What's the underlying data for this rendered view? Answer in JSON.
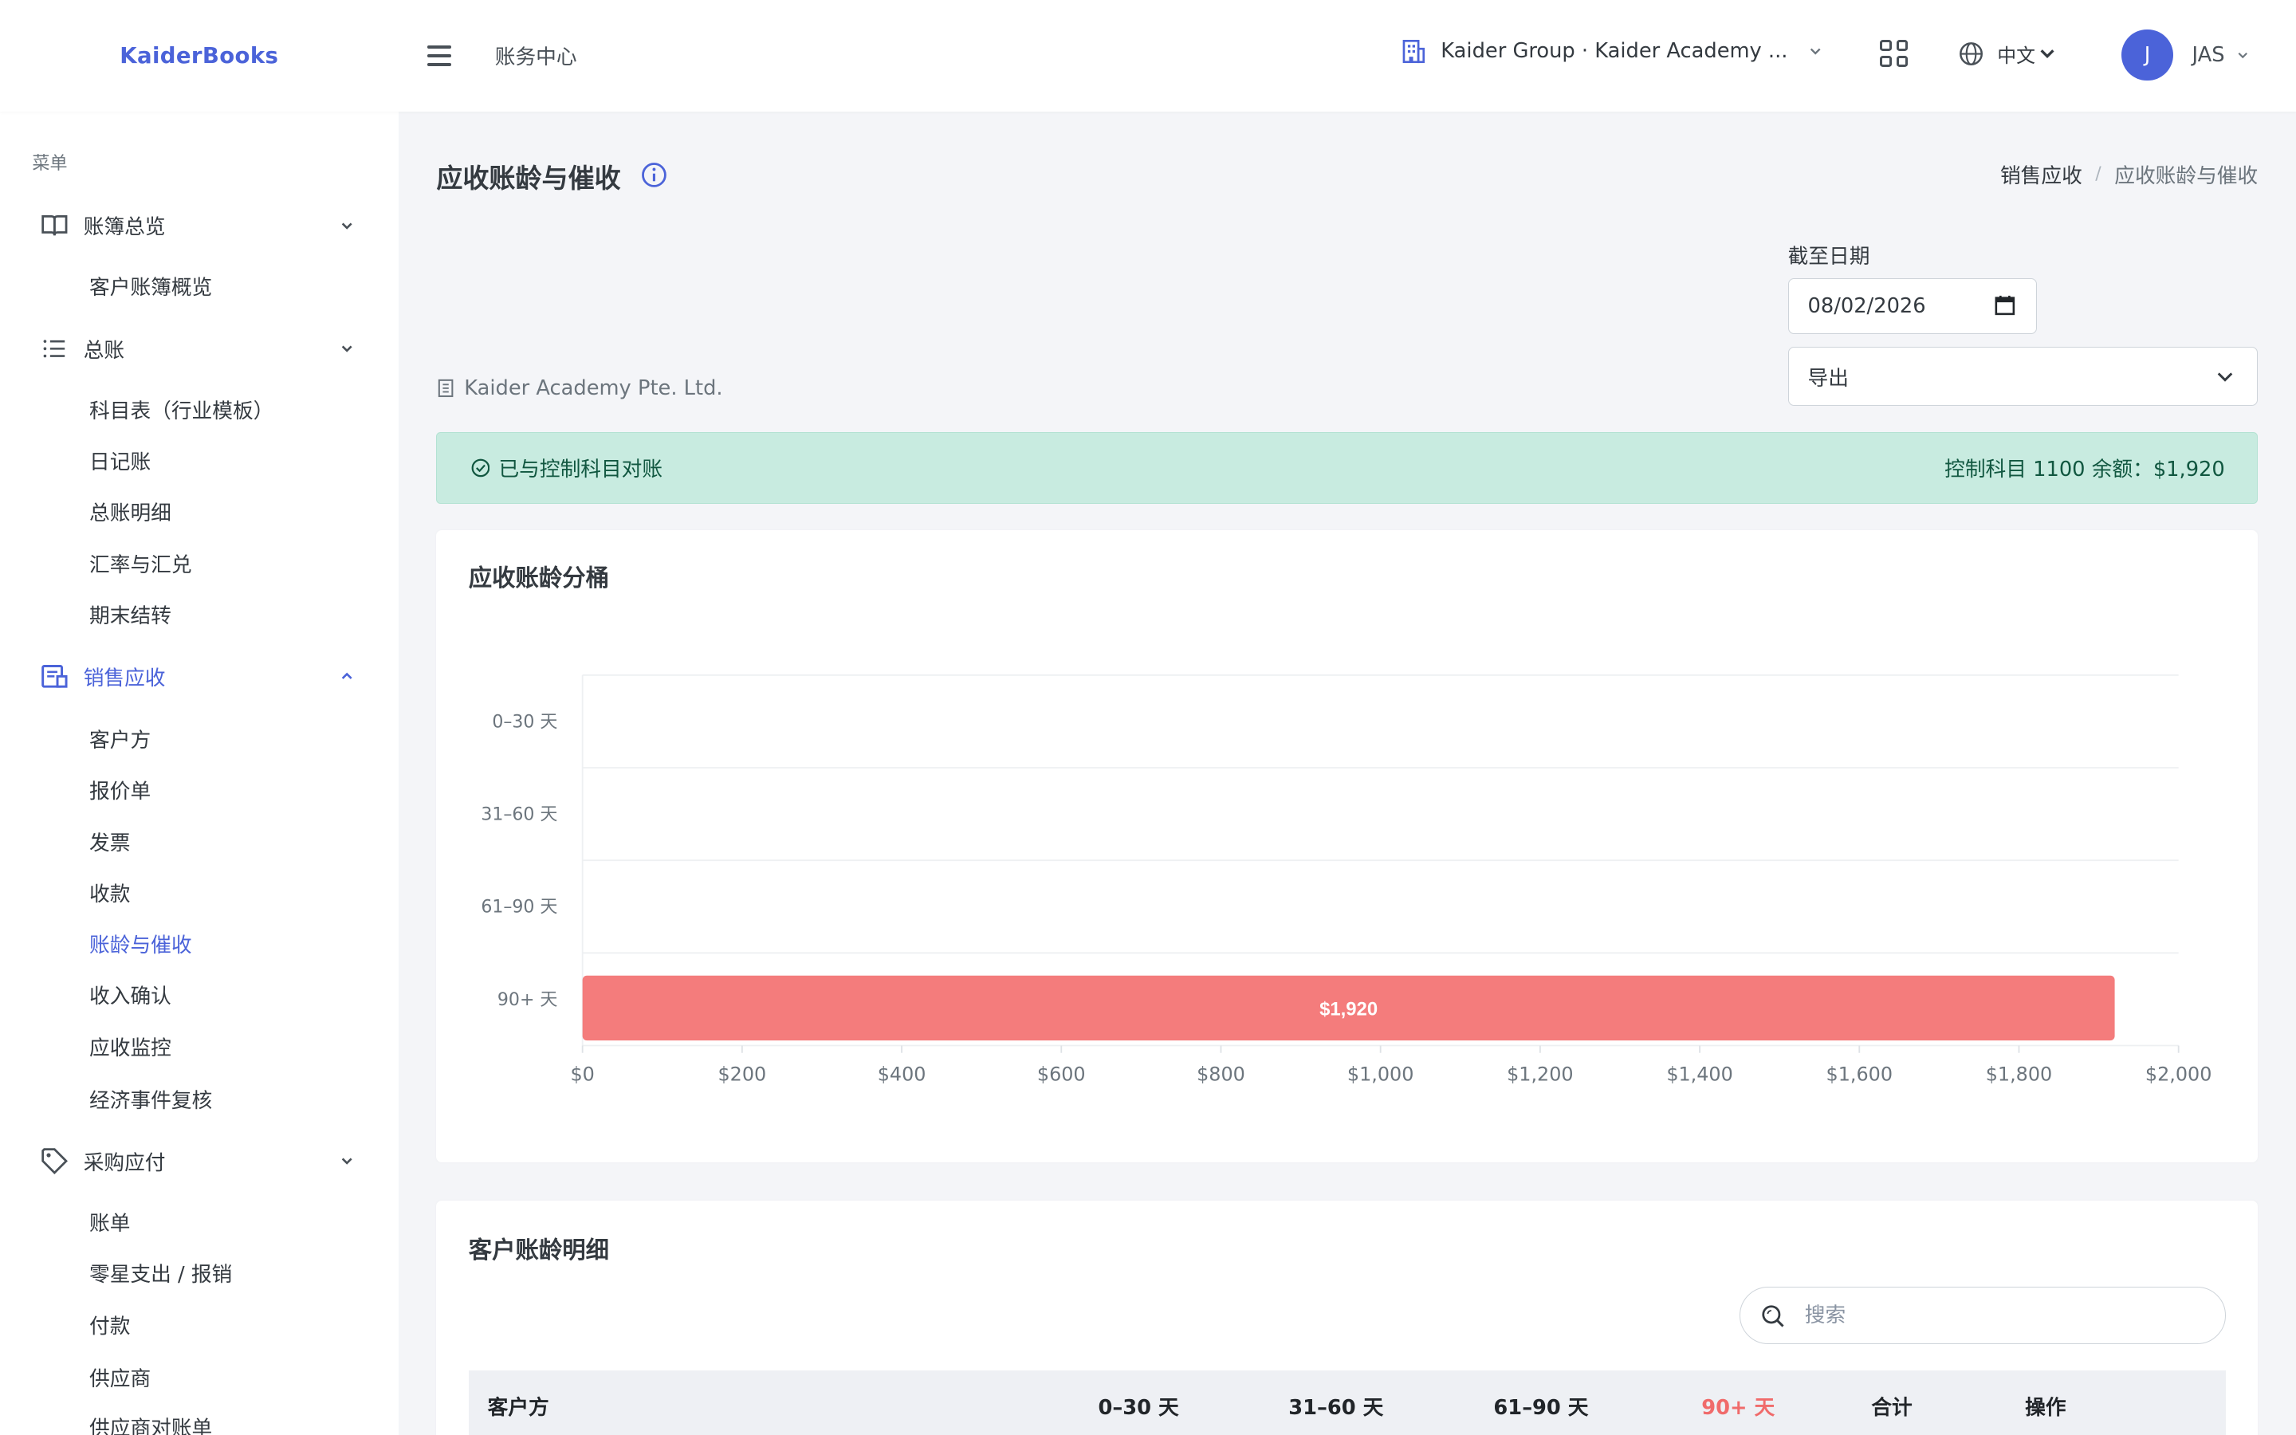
{
  "header": {
    "brand": "KaiderBooks",
    "page_context": "账务中心",
    "org_switcher": "Kaider Group · Kaider Academy ...",
    "language": "中文",
    "user_initial": "J",
    "user_name": "JAS"
  },
  "sidebar": {
    "menu_title": "菜单",
    "groups": [
      {
        "label": "账簿总览",
        "icon": "book-open-icon",
        "expanded": true,
        "items": [
          "客户账簿概览"
        ]
      },
      {
        "label": "总账",
        "icon": "list-icon",
        "expanded": true,
        "items": [
          "科目表（行业模板）",
          "日记账",
          "总账明细",
          "汇率与汇兑",
          "期末结转"
        ]
      },
      {
        "label": "销售应收",
        "icon": "receipt-icon",
        "expanded": true,
        "active": true,
        "items": [
          "客户方",
          "报价单",
          "发票",
          "收款",
          "账龄与催收",
          "收入确认",
          "应收监控",
          "经济事件复核"
        ]
      },
      {
        "label": "采购应付",
        "icon": "tag-icon",
        "expanded": true,
        "items": [
          "账单",
          "零星支出 / 报销",
          "付款",
          "供应商",
          "供应商对账单"
        ]
      }
    ],
    "active_item": "账龄与催收"
  },
  "page": {
    "title": "应收账龄与催收",
    "breadcrumb": [
      "销售应收",
      "应收账龄与催收"
    ],
    "company": "Kaider Academy Pte. Ltd.",
    "as_of_label": "截至日期",
    "as_of_value": "08/02/2026",
    "export_label": "导出"
  },
  "alert": {
    "message": "已与控制科目对账",
    "balance": "控制科目 1100 余额：$1,920",
    "color": "#c8ebe0"
  },
  "chart": {
    "title": "应收账龄分桶"
  },
  "chart_data": {
    "type": "bar",
    "orientation": "horizontal",
    "categories": [
      "0–30 天",
      "31–60 天",
      "61–90 天",
      "90+ 天"
    ],
    "values": [
      0,
      0,
      0,
      1920
    ],
    "data_labels": [
      "",
      "",
      "",
      "$1,920"
    ],
    "xlim": [
      0,
      2000
    ],
    "x_ticks": [
      "$0",
      "$200",
      "$400",
      "$600",
      "$800",
      "$1,000",
      "$1,200",
      "$1,400",
      "$1,600",
      "$1,800",
      "$2,000"
    ],
    "grid": true,
    "bar_color": "#f47c7c"
  },
  "table": {
    "title": "客户账龄明细",
    "search_placeholder": "搜索",
    "columns": [
      "客户方",
      "0–30 天",
      "31–60 天",
      "61–90 天",
      "90+ 天",
      "合计",
      "操作"
    ]
  },
  "colors": {
    "accent": "#4b63d9",
    "danger": "#f06b6b",
    "success_bg": "#c8ebe0"
  }
}
